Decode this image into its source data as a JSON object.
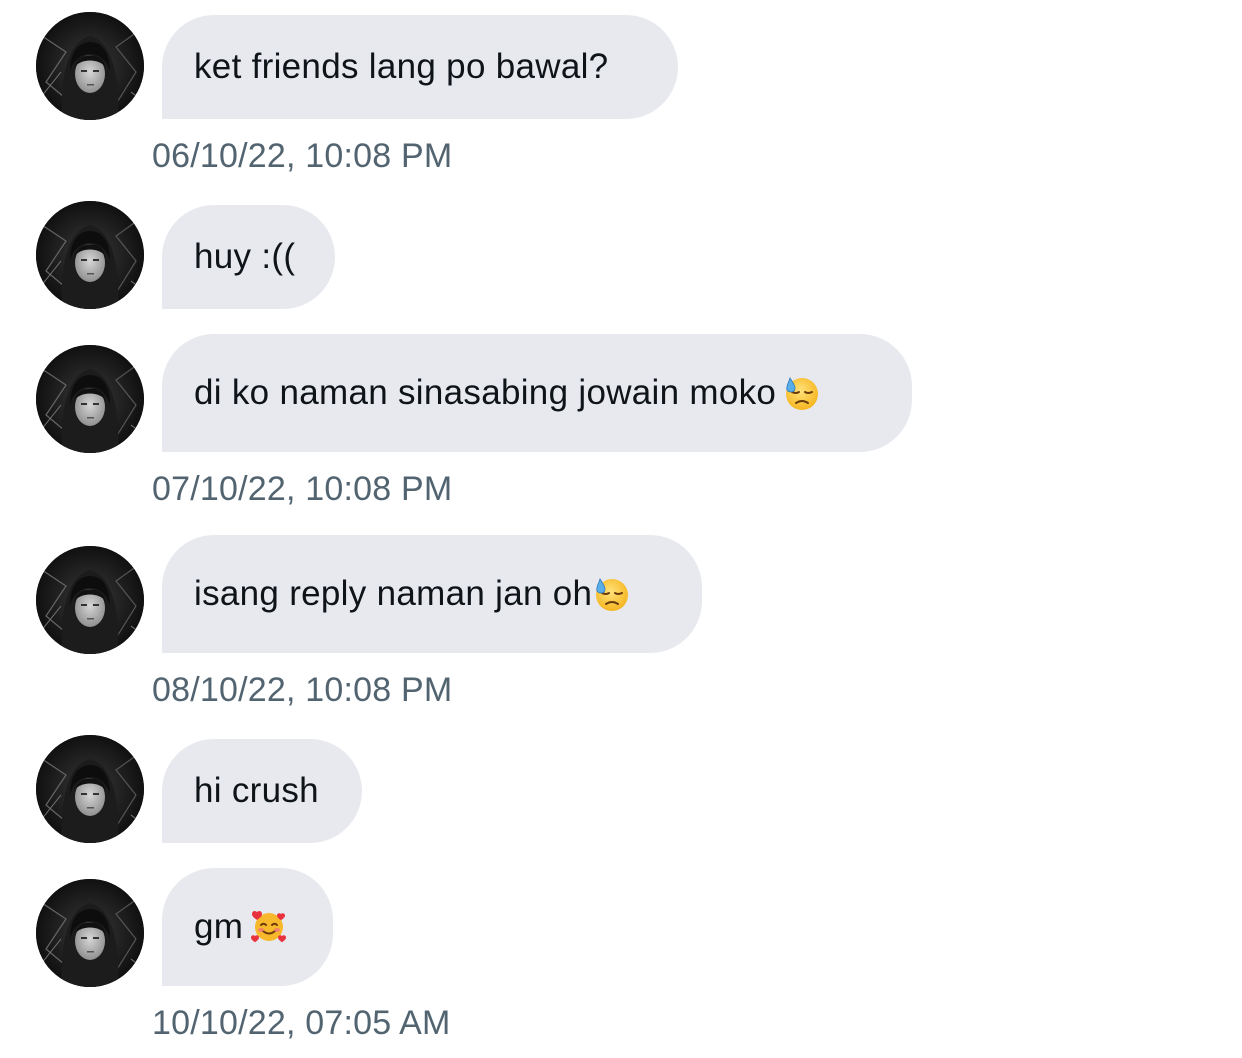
{
  "conversation": {
    "messages": [
      {
        "text": "ket friends lang po bawal?",
        "emoji": "",
        "timestamp": "06/10/22, 10:08 PM"
      },
      {
        "text": "huy :((",
        "emoji": "",
        "timestamp": ""
      },
      {
        "text": "di ko naman sinasabing jowain moko",
        "emoji": "downcast-face-with-sweat-icon",
        "timestamp": "07/10/22, 10:08 PM"
      },
      {
        "text": "isang reply naman jan oh",
        "emoji": "downcast-face-with-sweat-icon",
        "timestamp": "08/10/22, 10:08 PM"
      },
      {
        "text": "hi crush",
        "emoji": "",
        "timestamp": ""
      },
      {
        "text": "gm",
        "emoji": "smiling-face-with-hearts-icon",
        "timestamp": "10/10/22, 07:05 AM"
      }
    ]
  },
  "colors": {
    "bubble_background": "#e7e9ee",
    "message_text": "#0f1419",
    "timestamp_text": "#536471",
    "page_background": "#ffffff"
  }
}
